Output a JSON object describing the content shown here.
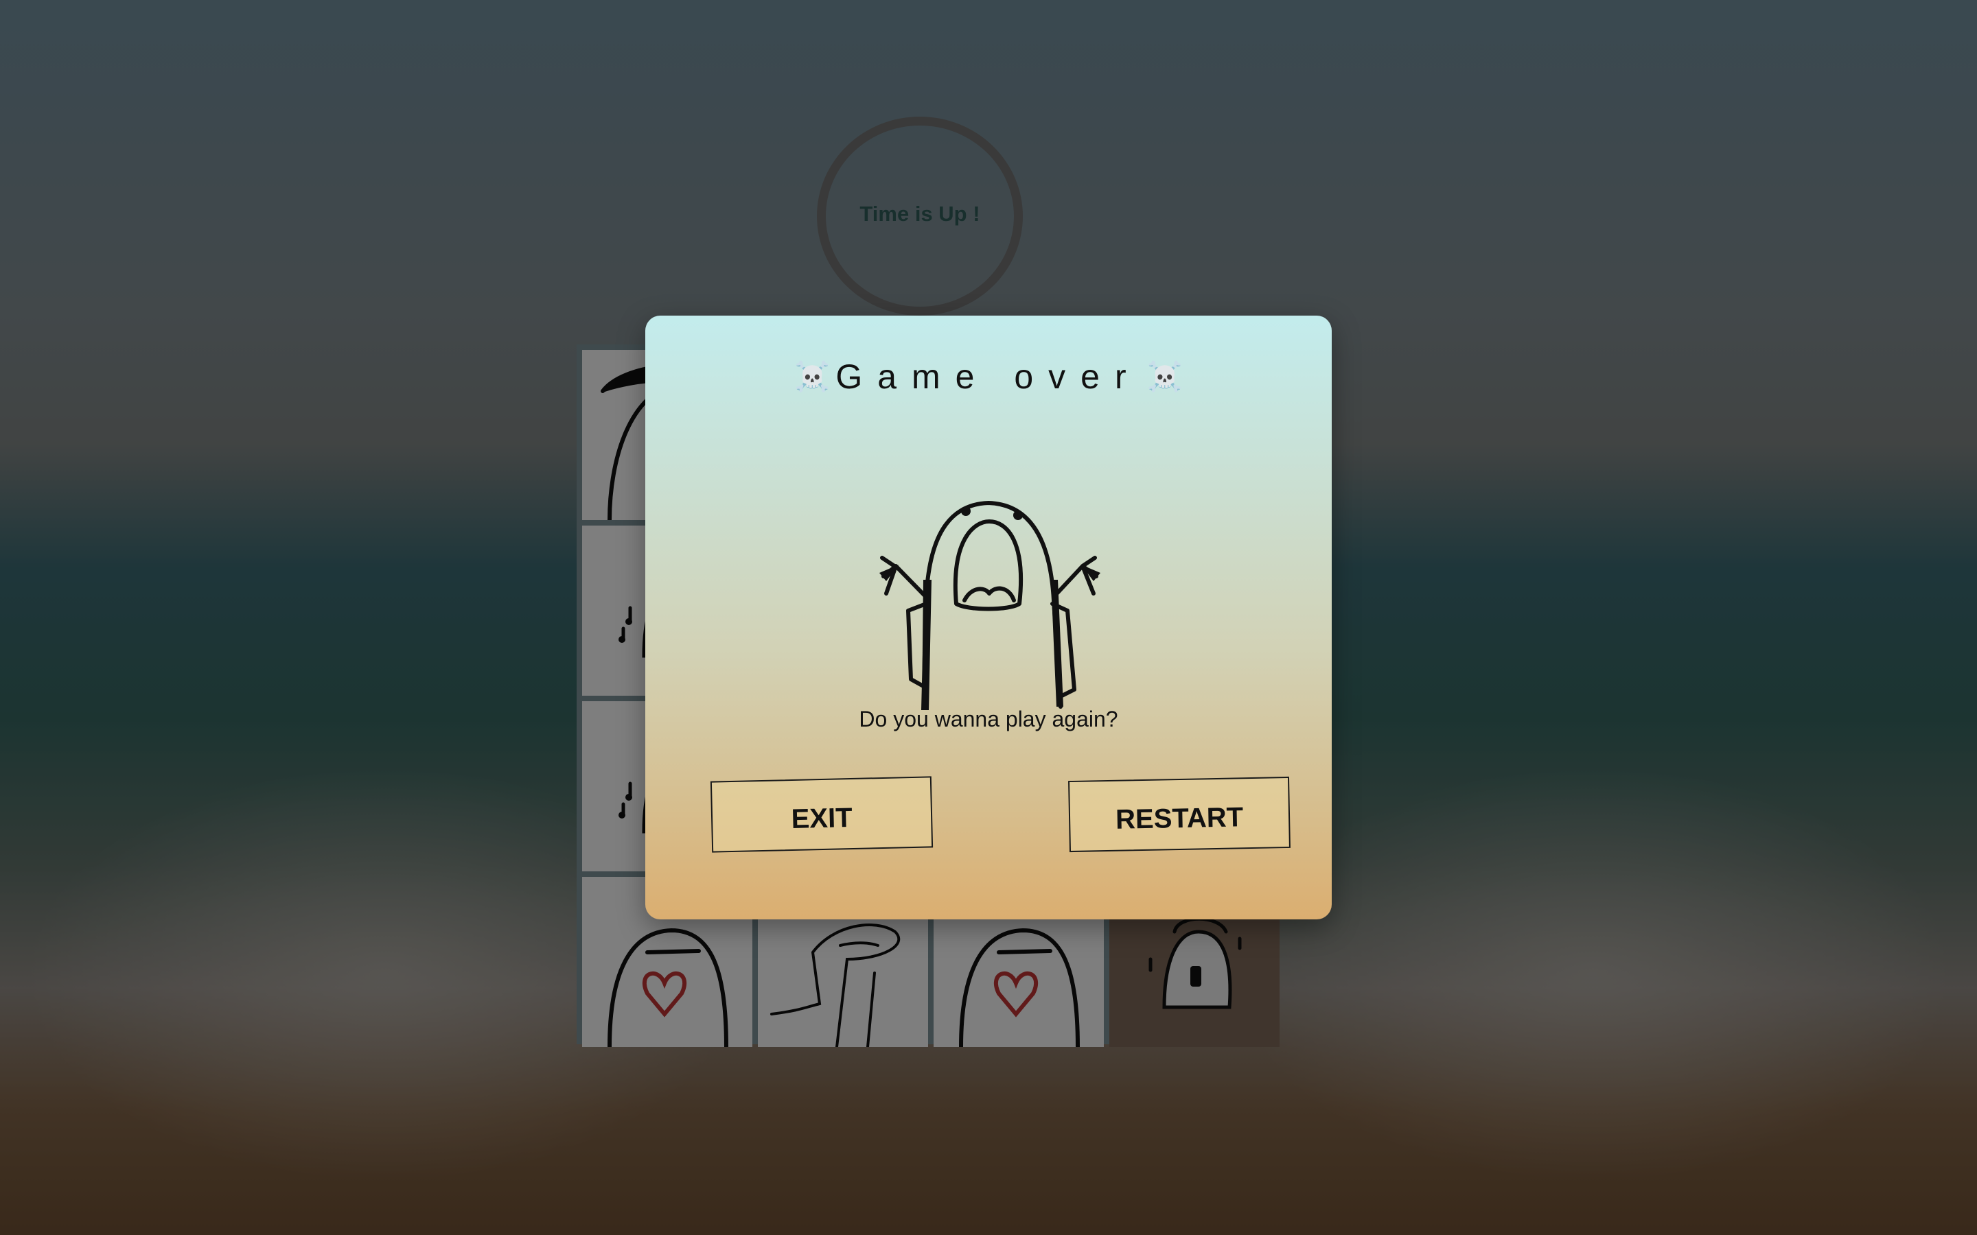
{
  "timer": {
    "text": "Time is Up !"
  },
  "board": {
    "rows": 4,
    "cols": 4,
    "cards": [
      "hat",
      "hidden",
      "hidden",
      "hidden",
      "music",
      "hidden",
      "hidden",
      "hidden",
      "music",
      "hidden",
      "hidden",
      "hidden",
      "heart",
      "relaxed",
      "heart",
      "music-dark"
    ]
  },
  "modal": {
    "title": "Game over",
    "title_icon": "skull-crossbones-icon",
    "figure": "screaming-character",
    "question": "Do you wanna play again?",
    "exit_label": "EXIT",
    "restart_label": "RESTART"
  },
  "colors": {
    "modal_top": "#c3eced",
    "modal_bottom": "#dbae70",
    "timer_text": "#2e5b57",
    "card_back": "#7b6656"
  }
}
